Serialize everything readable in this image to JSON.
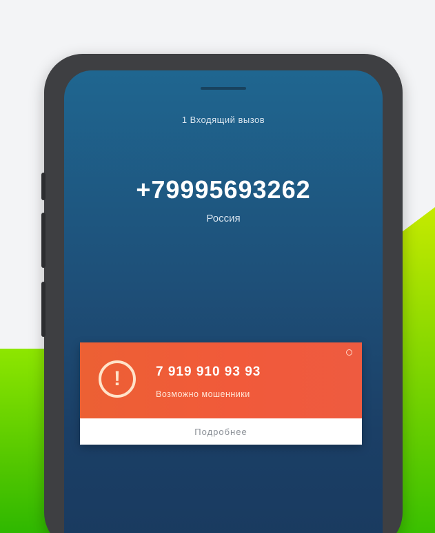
{
  "call": {
    "status_text": "1  Входящий вызов",
    "phone_number": "+79995693262",
    "caller_region": "Россия"
  },
  "alert": {
    "title": "7 919 910 93 93",
    "description": "Возможно мошенники",
    "action_label": "Подробнее",
    "icon": "exclamation-circle-icon",
    "accent_color": "#ee5b3a"
  },
  "colors": {
    "screen_top": "#1f6690",
    "screen_bottom": "#193a5f",
    "phone_frame": "#3e3f42"
  }
}
